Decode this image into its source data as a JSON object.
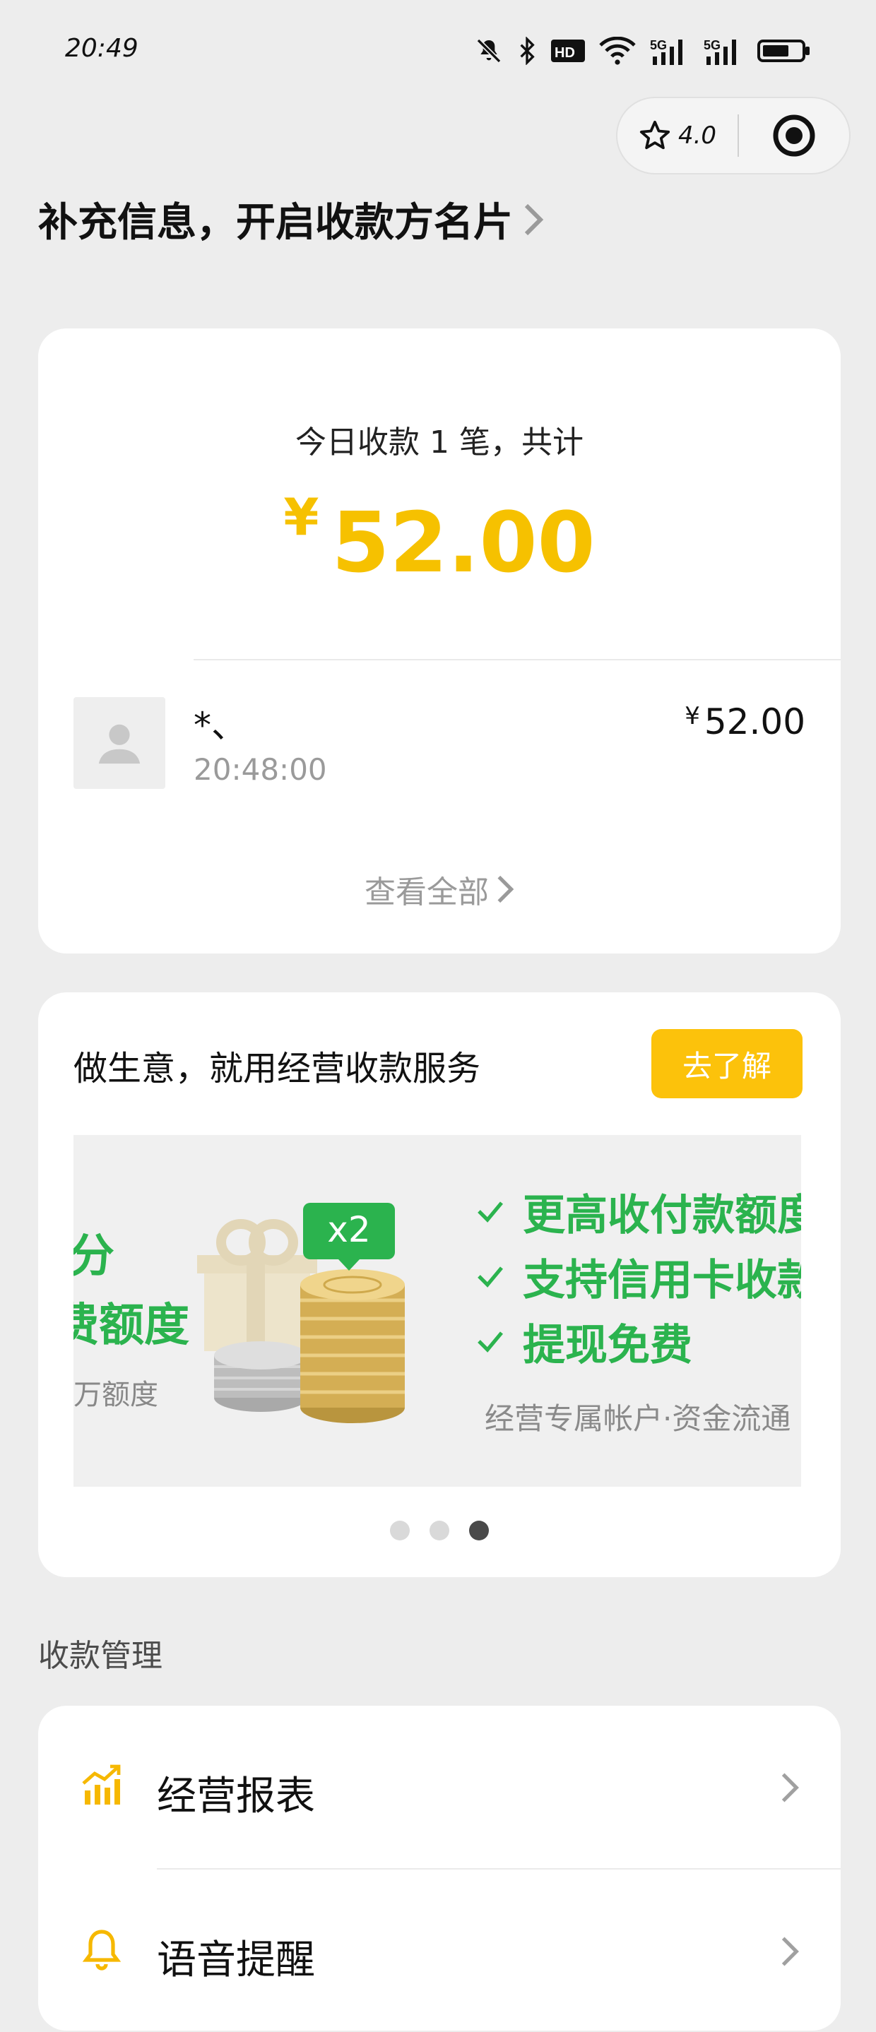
{
  "status_bar": {
    "time": "20:49"
  },
  "capsule": {
    "rating": "4.0"
  },
  "header": {
    "title": "补充信息，开启收款方名片"
  },
  "summary": {
    "label": "今日收款 1 笔，共计",
    "currency_symbol": "¥",
    "amount": "52.00",
    "amount_color": "#f6c100",
    "transaction": {
      "name": "*、",
      "time": "20:48:00",
      "currency_symbol": "¥",
      "amount": "52.00"
    },
    "view_all_label": "查看全部"
  },
  "promo": {
    "title": "做生意，就用经营收款服务",
    "button_label": "去了解",
    "button_color": "#fcc20b",
    "banner": {
      "left_line1": "分",
      "left_line2": "费额度",
      "left_line3": "万额度",
      "badge": "x2",
      "benefits": [
        "更高收付款额度",
        "支持信用卡收款",
        "提现免费"
      ],
      "footnote": "经营专属帐户·资金流通",
      "accent_color": "#2bb34e"
    },
    "pager": {
      "count": 3,
      "active_index": 2
    }
  },
  "management": {
    "section_label": "收款管理",
    "items": [
      {
        "label": "经营报表",
        "icon": "chart-icon"
      },
      {
        "label": "语音提醒",
        "icon": "bell-icon"
      }
    ]
  }
}
